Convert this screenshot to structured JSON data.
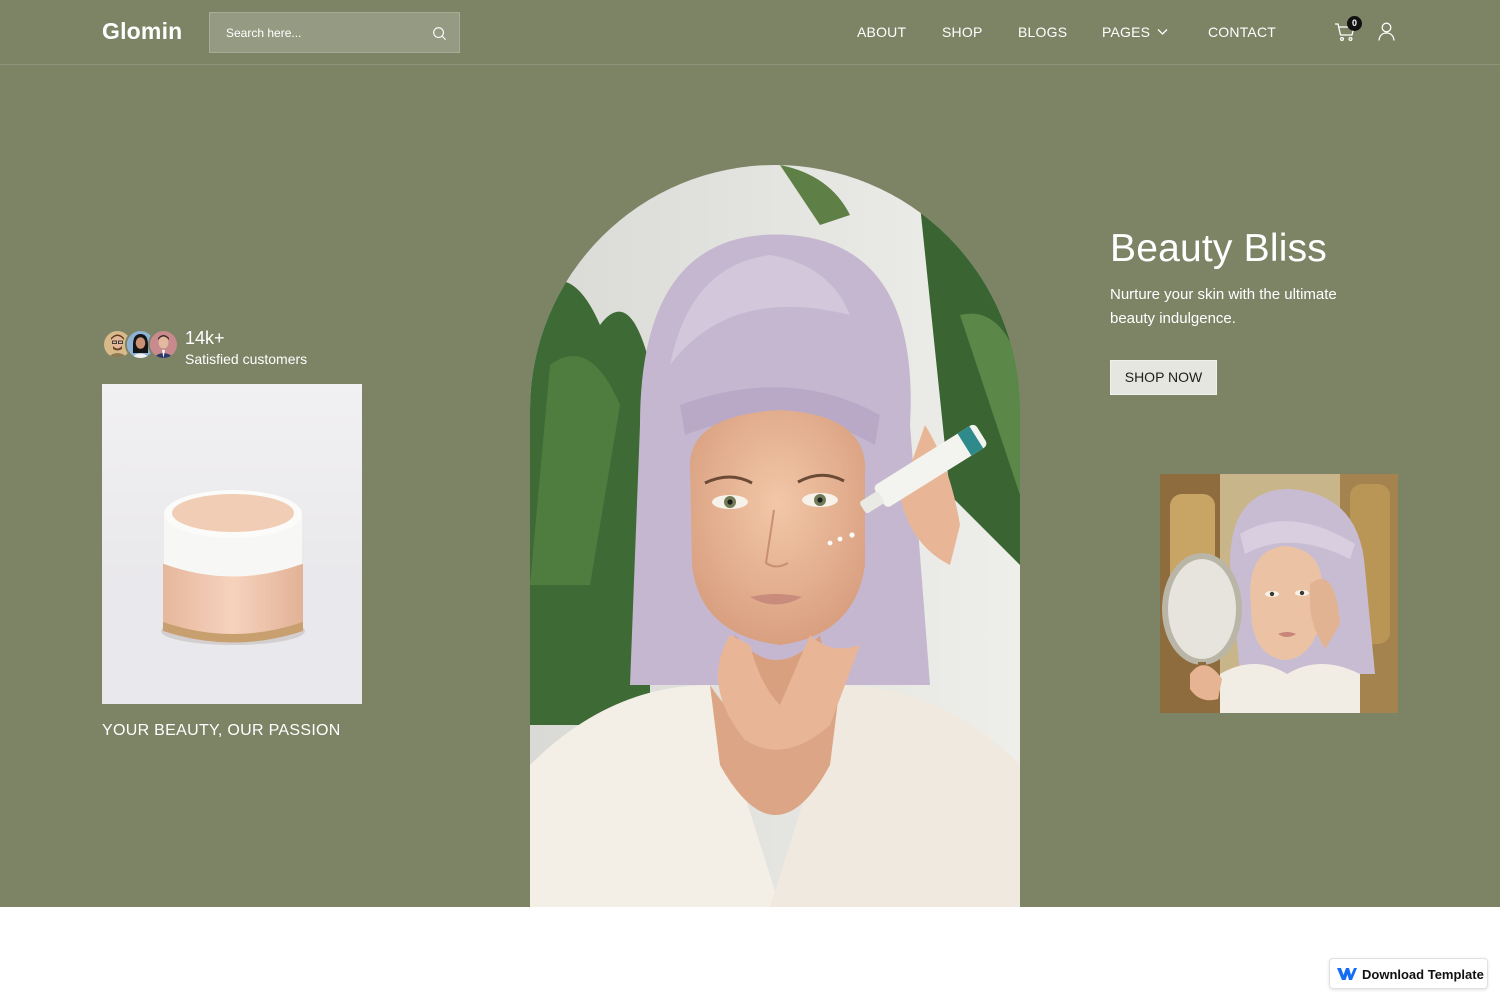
{
  "brand": {
    "logo": "Glomin"
  },
  "search": {
    "placeholder": "Search here..."
  },
  "nav": {
    "items": [
      {
        "label": "ABOUT"
      },
      {
        "label": "SHOP"
      },
      {
        "label": "BLOGS"
      },
      {
        "label": "PAGES"
      },
      {
        "label": "CONTACT"
      }
    ]
  },
  "cart": {
    "count": "0"
  },
  "social_proof": {
    "count": "14k+",
    "label": "Satisfied customers"
  },
  "hero": {
    "title": "Beauty Bliss",
    "subtitle": "Nurture your skin with the ultimate beauty indulgence.",
    "cta_label": "SHOP NOW",
    "tagline": "YOUR BEAUTY, OUR PASSION"
  },
  "footer_badge": {
    "label": "Download Template"
  },
  "colors": {
    "hero_background": "#7d8466",
    "text": "#ffffff",
    "button_background": "#e5e6df",
    "webflow_blue": "#146ef5"
  }
}
